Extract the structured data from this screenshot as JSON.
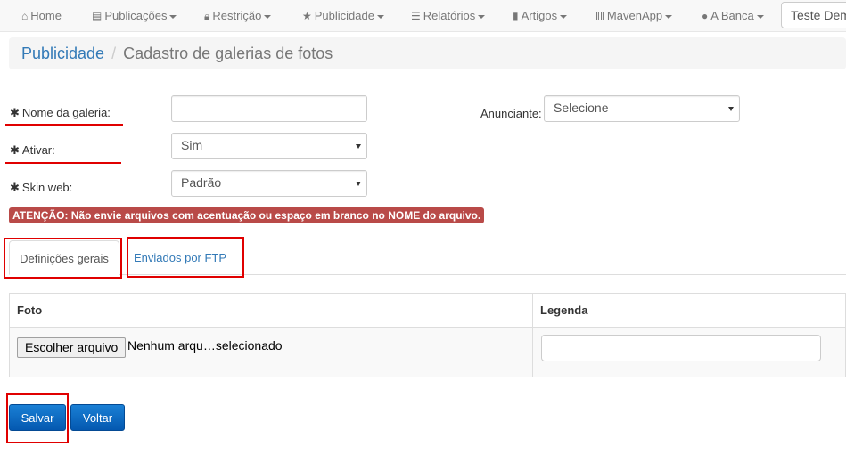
{
  "navbar": {
    "items": [
      {
        "label": "Home",
        "icon": "home-icon",
        "caret": false
      },
      {
        "label": "Publicações",
        "icon": "book-icon",
        "caret": true
      },
      {
        "label": "Restrição",
        "icon": "lock-icon",
        "caret": true
      },
      {
        "label": "Publicidade",
        "icon": "star-icon",
        "caret": true
      },
      {
        "label": "Relatórios",
        "icon": "list-icon",
        "caret": true
      },
      {
        "label": "Artigos",
        "icon": "bookmark-icon",
        "caret": true
      },
      {
        "label": "MavenApp",
        "icon": "barcode-icon",
        "caret": true
      },
      {
        "label": "A Banca",
        "icon": "globe-icon",
        "caret": true
      }
    ],
    "search_value": "Teste Dem"
  },
  "breadcrumb": {
    "link": "Publicidade",
    "separator": "/",
    "active": "Cadastro de galerias de fotos"
  },
  "form": {
    "nome_label": "Nome da galeria:",
    "nome_value": "",
    "ativar_label": "Ativar:",
    "ativar_value": "Sim",
    "skin_label": "Skin web:",
    "skin_value": "Padrão",
    "anunciante_label": "Anunciante:",
    "anunciante_value": "Selecione",
    "required_mark": "✱"
  },
  "alert": {
    "text": "ATENÇÃO: Não envie arquivos com acentuação ou espaço em branco no NOME do arquivo.",
    "color": "#b94a48"
  },
  "tabs": [
    {
      "label": "Definições gerais",
      "active": true
    },
    {
      "label": "Enviados por FTP",
      "active": false
    }
  ],
  "table": {
    "headers": [
      "Foto",
      "Legenda"
    ],
    "file_button_label": "Escolher arquivo",
    "file_status": "Nenhum arqu…selecionado",
    "legend_value": ""
  },
  "buttons": {
    "save": "Salvar",
    "back": "Voltar"
  },
  "colors": {
    "accent_blue": "#337ab7",
    "highlight_red": "#e00000",
    "button_blue": "#0b6fcf"
  }
}
